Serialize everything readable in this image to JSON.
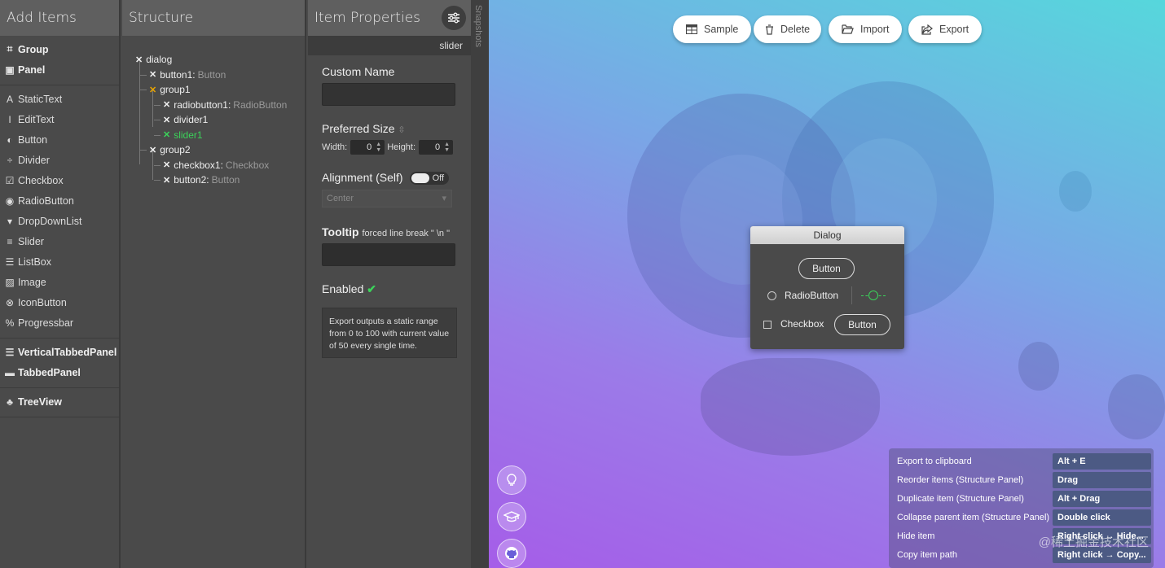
{
  "add_items": {
    "title": "Add Items",
    "groups": [
      [
        {
          "label": "Group",
          "icon": "group-icon",
          "bold": true
        },
        {
          "label": "Panel",
          "icon": "panel-icon",
          "bold": true
        }
      ],
      [
        {
          "label": "StaticText",
          "icon": "text-icon"
        },
        {
          "label": "EditText",
          "icon": "cursor-icon"
        },
        {
          "label": "Button",
          "icon": "toggle-icon"
        },
        {
          "label": "Divider",
          "icon": "divider-icon"
        },
        {
          "label": "Checkbox",
          "icon": "checkbox-icon"
        },
        {
          "label": "RadioButton",
          "icon": "radio-icon"
        },
        {
          "label": "DropDownList",
          "icon": "dropdown-icon"
        },
        {
          "label": "Slider",
          "icon": "slider-icon"
        },
        {
          "label": "ListBox",
          "icon": "listbox-icon"
        },
        {
          "label": "Image",
          "icon": "image-icon"
        },
        {
          "label": "IconButton",
          "icon": "iconbutton-icon"
        },
        {
          "label": "Progressbar",
          "icon": "percent-icon"
        }
      ],
      [
        {
          "label": "VerticalTabbedPanel",
          "icon": "list-icon",
          "bold": true
        },
        {
          "label": "TabbedPanel",
          "icon": "folder-icon",
          "bold": true
        }
      ],
      [
        {
          "label": "TreeView",
          "icon": "tree-icon",
          "bold": true
        }
      ]
    ]
  },
  "structure": {
    "title": "Structure",
    "nodes": [
      {
        "name": "dialog",
        "type": "",
        "depth": 0
      },
      {
        "name": "button1:",
        "type": "Button",
        "depth": 1
      },
      {
        "name": "group1",
        "type": "",
        "depth": 1,
        "active": true
      },
      {
        "name": "radiobutton1:",
        "type": "RadioButton",
        "depth": 2
      },
      {
        "name": "divider1",
        "type": "",
        "depth": 2
      },
      {
        "name": "slider1",
        "type": "",
        "depth": 2,
        "selected": true
      },
      {
        "name": "group2",
        "type": "",
        "depth": 1
      },
      {
        "name": "checkbox1:",
        "type": "Checkbox",
        "depth": 2
      },
      {
        "name": "button2:",
        "type": "Button",
        "depth": 2
      }
    ]
  },
  "props": {
    "title": "Item Properties",
    "selected": "slider",
    "custom_name": "Custom Name",
    "preferred_size": "Preferred Size",
    "width_label": "Width:",
    "width": "0",
    "height_label": "Height:",
    "height": "0",
    "alignment": "Alignment (Self)",
    "toggle": "Off",
    "align_value": "Center",
    "tooltip": "Tooltip",
    "tooltip_hint": "forced line break \" \\n \"",
    "enabled": "Enabled",
    "note": "Export outputs a static range from 0 to 100 with current value of 50 every single time."
  },
  "snapshots": "Snapshots",
  "toolbar": {
    "sample": "Sample",
    "delete": "Delete",
    "import": "Import",
    "export": "Export"
  },
  "dialog": {
    "title": "Dialog",
    "button1": "Button",
    "radio": "RadioButton",
    "checkbox": "Checkbox",
    "button2": "Button"
  },
  "shortcuts": [
    {
      "action": "Export to clipboard",
      "key": "Alt + E"
    },
    {
      "action": "Reorder items (Structure Panel)",
      "key": "Drag"
    },
    {
      "action": "Duplicate item (Structure Panel)",
      "key": "Alt + Drag"
    },
    {
      "action": "Collapse parent item (Structure Panel)",
      "key": "Double click"
    },
    {
      "action": "Hide item",
      "key": "Right click → Hide..."
    },
    {
      "action": "Copy item path",
      "key": "Right click → Copy..."
    }
  ],
  "watermark": "@稀土掘金技术社区",
  "colors": {
    "accent_green": "#3bd35a",
    "active_orange": "#e8a400"
  }
}
